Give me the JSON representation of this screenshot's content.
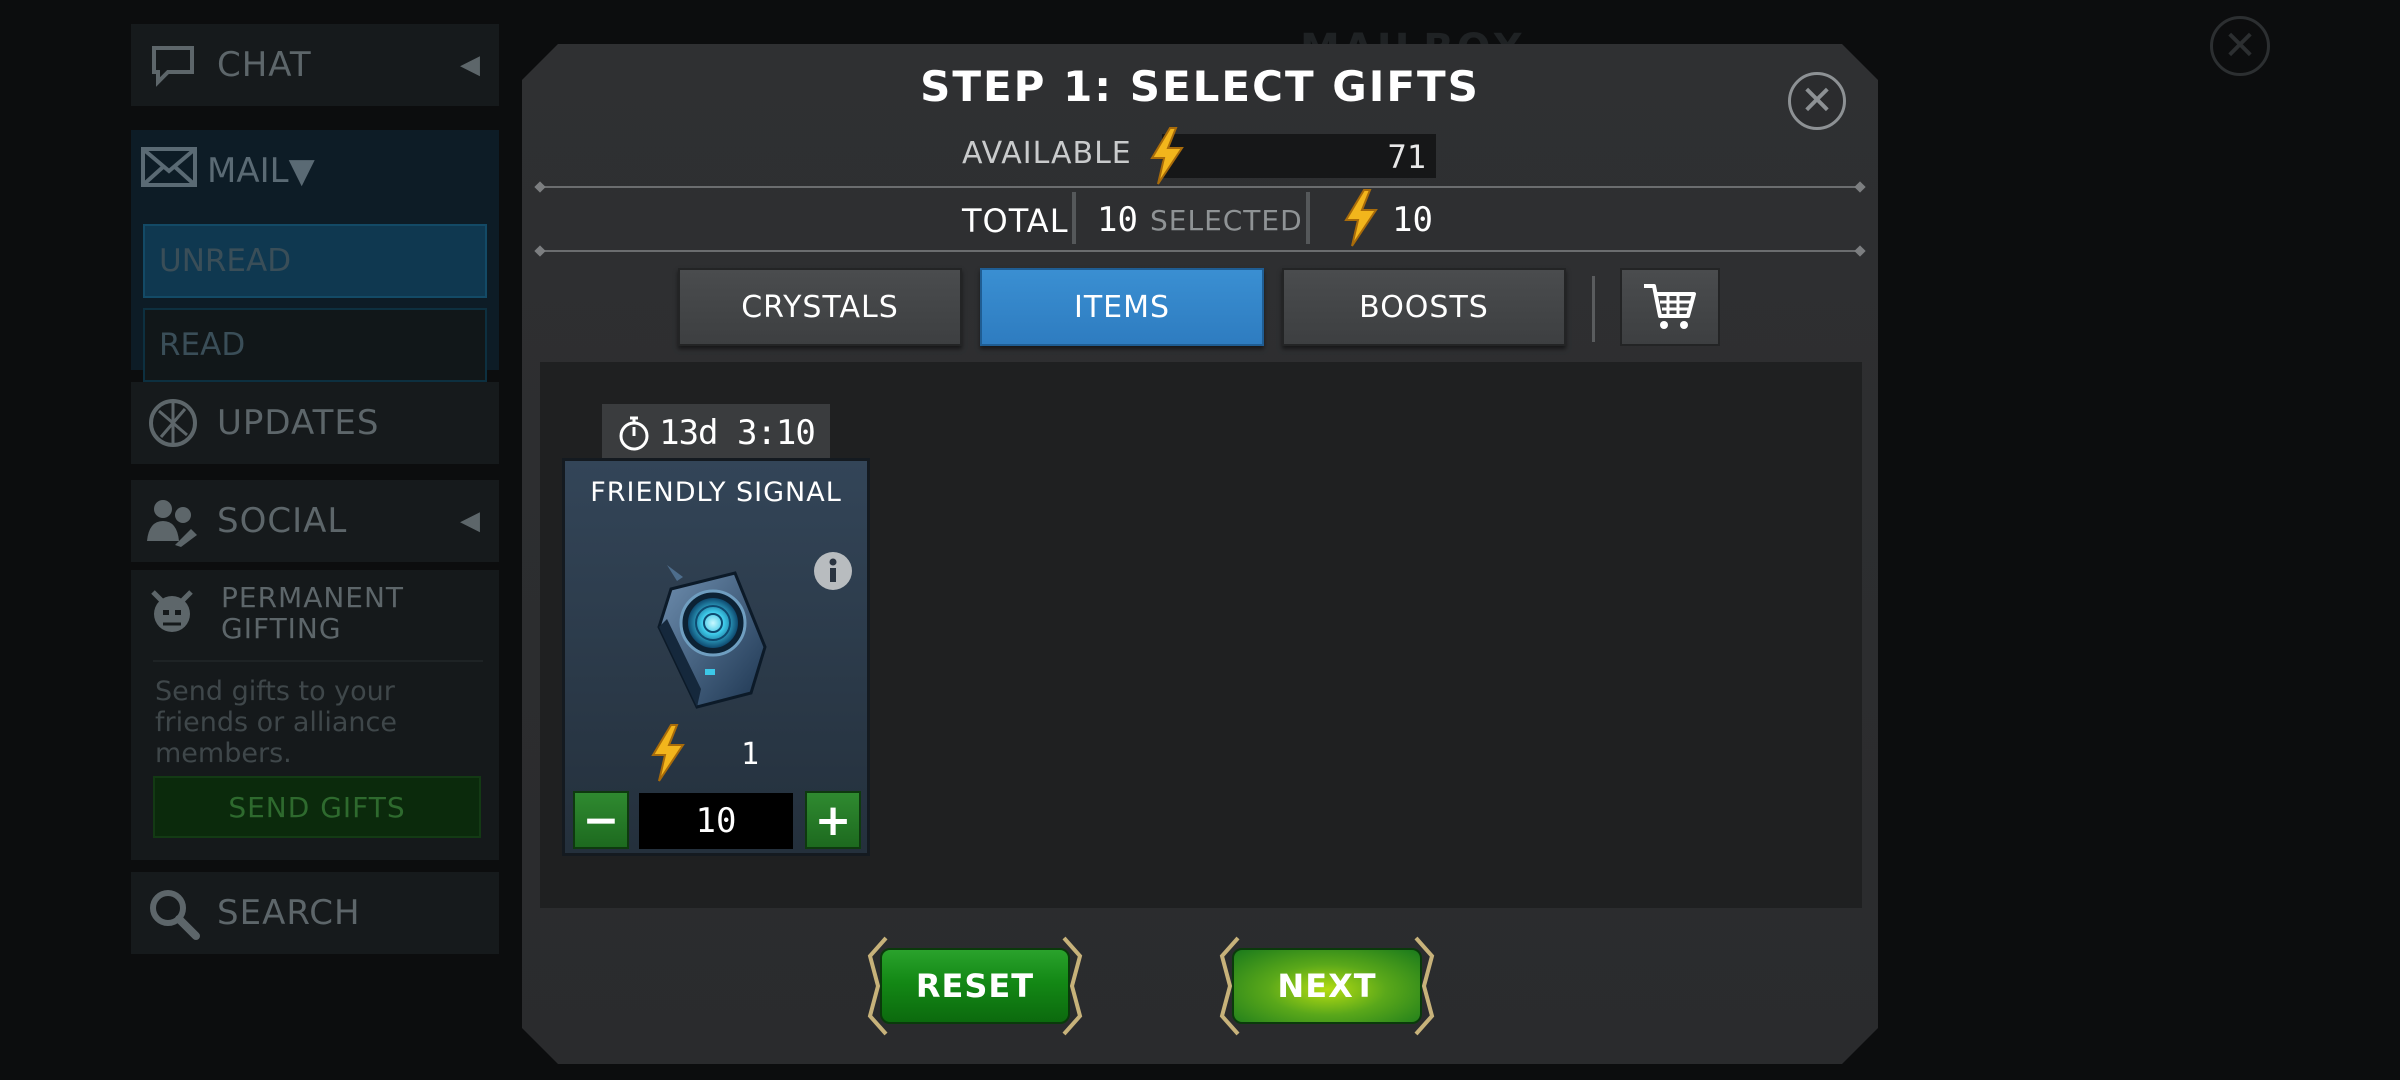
{
  "background": {
    "mailbox_title": "MAILBOX",
    "sidebar": {
      "chat": "CHAT",
      "mail": "MAIL",
      "unread": "UNREAD",
      "read": "READ",
      "updates": "UPDATES",
      "social": "SOCIAL",
      "permanent_gifting": "PERMANENT GIFTING",
      "gifting_desc": "Send gifts to your friends or alliance members.",
      "send_gifts": "SEND GIFTS",
      "search": "SEARCH"
    }
  },
  "modal": {
    "title": "STEP 1: SELECT GIFTS",
    "available_label": "AVAILABLE",
    "available_value": "71",
    "total_label": "TOTAL",
    "selected_count": "10",
    "selected_label": "SELECTED",
    "selected_cost": "10",
    "tabs": [
      {
        "label": "CRYSTALS",
        "active": false
      },
      {
        "label": "ITEMS",
        "active": true
      },
      {
        "label": "BOOSTS",
        "active": false
      }
    ],
    "item": {
      "timer": "13d 3:10",
      "name": "FRIENDLY SIGNAL",
      "cost": "1",
      "quantity": "10"
    },
    "reset_label": "RESET",
    "next_label": "NEXT"
  },
  "colors": {
    "accent_blue": "#2e7cc0",
    "button_green": "#138815",
    "next_highlight": "#b4dc12",
    "energy_gold": "#f2b51c"
  },
  "icons": [
    "chat-icon",
    "mail-icon",
    "updates-icon",
    "social-icon",
    "gifting-icon",
    "search-icon",
    "close-icon",
    "energy-bolt-icon",
    "cart-icon",
    "stopwatch-icon",
    "info-icon",
    "friendly-signal-item"
  ]
}
